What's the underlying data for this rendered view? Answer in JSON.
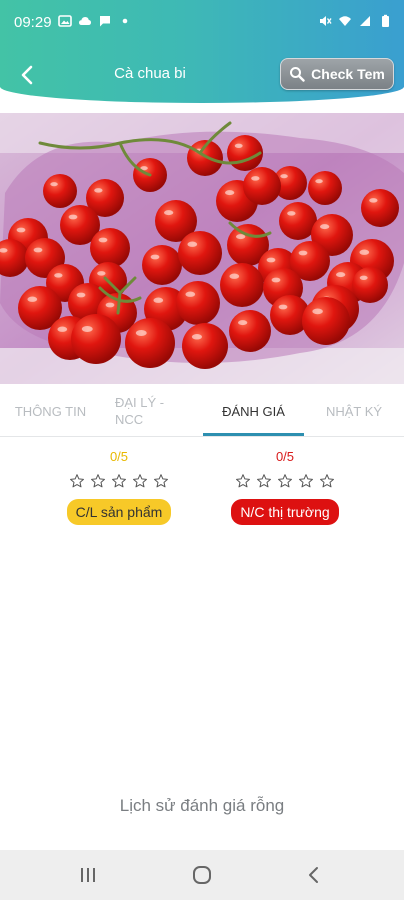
{
  "status_bar": {
    "time": "09:29",
    "left_icons": [
      "image-icon",
      "cloud-icon",
      "chat-icon",
      "dot-icon"
    ],
    "right_icons": [
      "mute-icon",
      "wifi-icon",
      "signal-icon",
      "battery-icon"
    ]
  },
  "app_bar": {
    "title": "Cà chua bi",
    "check_button_label": "Check Tem"
  },
  "product_image": {
    "alt_subject": "cherry-tomatoes-photo"
  },
  "tabs": [
    {
      "label": "THÔNG TIN",
      "active": false
    },
    {
      "label": "ĐẠI LÝ - NCC",
      "active": false
    },
    {
      "label": "ĐÁNH GIÁ",
      "active": true
    },
    {
      "label": "NHẬT KÝ",
      "active": false
    }
  ],
  "ratings": [
    {
      "score": "0/5",
      "stars": 0,
      "max_stars": 5,
      "badge": "C/L sản phẩm",
      "score_color": "#e8b800",
      "badge_bg": "#f7c928",
      "badge_text_color": "#333333"
    },
    {
      "score": "0/5",
      "stars": 0,
      "max_stars": 5,
      "badge": "N/C thị trường",
      "score_color": "#d81b1b",
      "badge_bg": "#dd1111",
      "badge_text_color": "#ffffff"
    }
  ],
  "empty_message": "Lịch sử đánh giá rỗng",
  "colors": {
    "header_start": "#43c3a6",
    "header_end": "#3a9fd0",
    "tab_indicator": "#2d8fb0"
  },
  "navbar": [
    "recent-apps-icon",
    "home-icon",
    "back-nav-icon"
  ]
}
